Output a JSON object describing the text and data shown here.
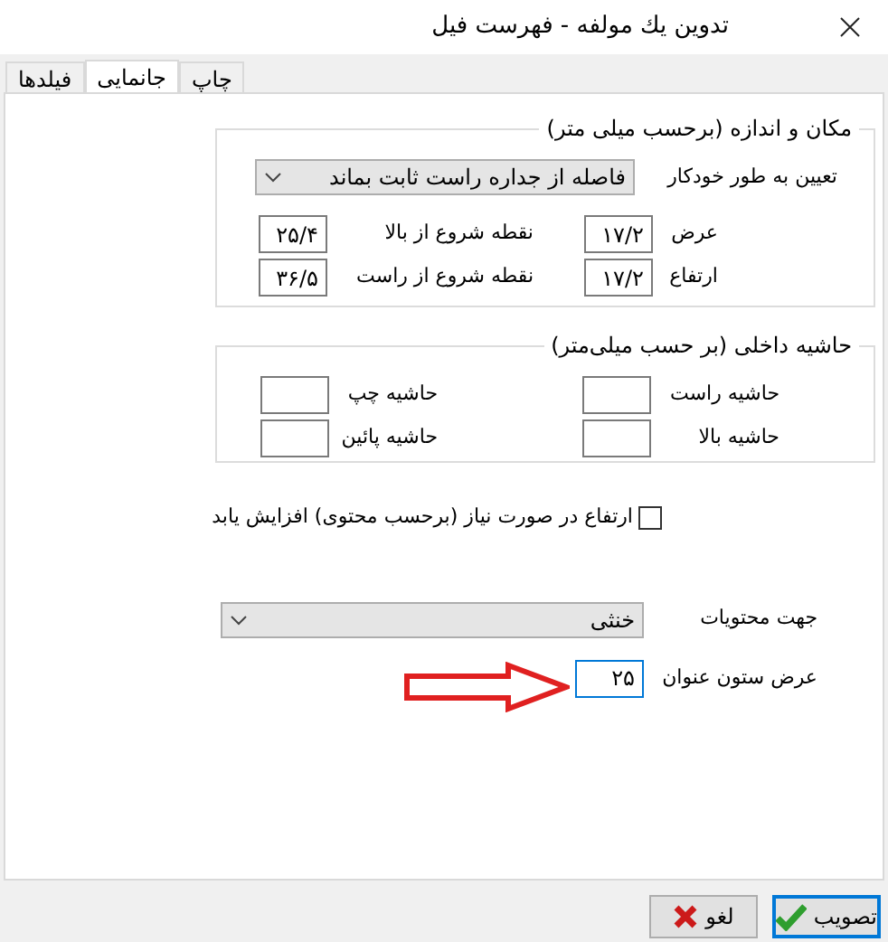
{
  "window": {
    "title": "تدوين يك مولفه - فهرست فيل"
  },
  "tabs": [
    {
      "label": "چاپ",
      "selected": false
    },
    {
      "label": "جانمایی",
      "selected": true
    },
    {
      "label": "فیلدها",
      "selected": false
    }
  ],
  "position_group": {
    "title": "مكان و اندازه (برحسب ميلی متر)",
    "auto_label": "تعيين به طور خودكار",
    "auto_value": "فاصله از جداره راست ثابت بماند",
    "fields": [
      {
        "label": "عرض",
        "value": "۱۷/۲"
      },
      {
        "label": "نقطه شروع از بالا",
        "value": "۲۵/۴"
      },
      {
        "label": "ارتفاع",
        "value": "۱۷/۲"
      },
      {
        "label": "نقطه شروع از راست",
        "value": "۳۶/۵"
      }
    ]
  },
  "padding_group": {
    "title": "حاشيه داخلی (بر حسب ميلی‌متر)",
    "fields": [
      {
        "label": "حاشيه راست"
      },
      {
        "label": "حاشيه چپ"
      },
      {
        "label": "حاشيه بالا"
      },
      {
        "label": "حاشيه پائين"
      }
    ]
  },
  "grow_checkbox": {
    "label": "ارتفاع در صورت نياز (برحسب محتوی) افزايش يابد",
    "checked": false
  },
  "direction": {
    "label": "جهت محتويات",
    "value": "خنثی"
  },
  "title_width": {
    "label": "عرض ستون عنوان",
    "value": "۲۵",
    "focused": true
  },
  "buttons": [
    {
      "label": "تصويب",
      "kind": "ok",
      "focused": true
    },
    {
      "label": "لغو",
      "kind": "cancel",
      "focused": false
    }
  ]
}
